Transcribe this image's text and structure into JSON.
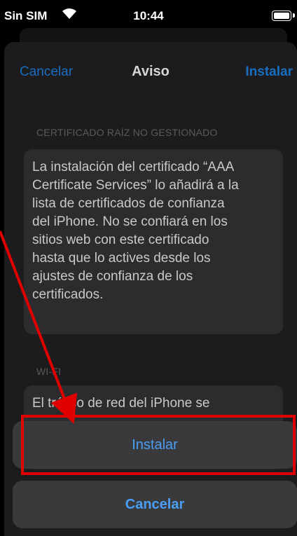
{
  "status_bar": {
    "carrier": "Sin SIM",
    "time": "10:44"
  },
  "nav": {
    "cancel": "Cancelar",
    "title": "Aviso",
    "install": "Instalar"
  },
  "sections": [
    {
      "header": "CERTIFICADO RAÍZ NO GESTIONADO",
      "lines": [
        "La instalación del certificado “AAA",
        "Certificate Services” lo añadirá a la",
        "lista de certificados de confianza",
        "del iPhone. No se confiará en los",
        "sitios web con este certificado",
        "hasta que lo actives desde los",
        "ajustes de confianza de los",
        "certificados."
      ]
    },
    {
      "header": "WI-FI",
      "lines": [
        "El tráfico de red del iPhone se"
      ]
    }
  ],
  "actions": {
    "install": "Instalar",
    "cancel": "Cancelar"
  },
  "colors": {
    "accent": "#4a9ff5",
    "annotation": "#e00000"
  }
}
